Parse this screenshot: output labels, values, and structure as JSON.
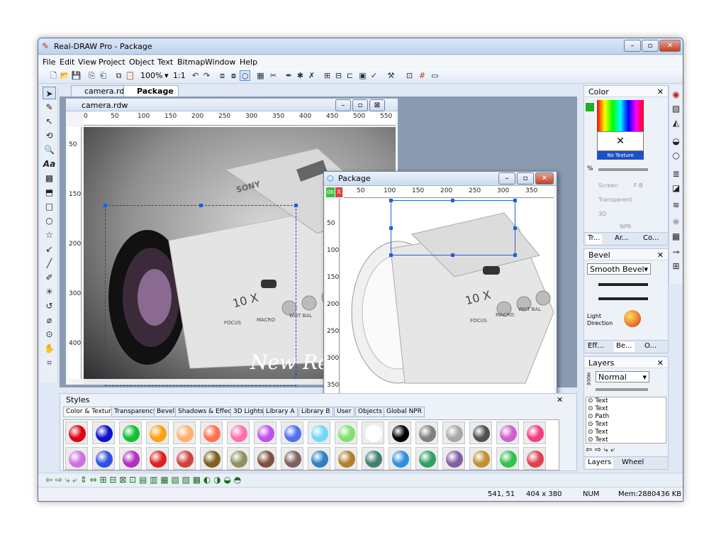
{
  "window": {
    "title": "Real-DRAW Pro - Package",
    "min": "–",
    "max": "▫",
    "close": "✕"
  },
  "menu": [
    "File",
    "Edit",
    "View",
    "Project",
    "Object",
    "Text",
    "Bitmap",
    "Window",
    "Help"
  ],
  "toolbar": {
    "zoom": "100%",
    "ratio": "1:1"
  },
  "doc_tabs": [
    "camera.rdw",
    "Package"
  ],
  "camera_window": {
    "title": "camera.rdw",
    "ruler": [
      "0",
      "50",
      "100",
      "150",
      "200",
      "250",
      "300",
      "350",
      "400",
      "450",
      "500",
      "550"
    ],
    "vruler": [
      "0",
      "50",
      "100",
      "150",
      "200",
      "250",
      "300",
      "350",
      "400"
    ],
    "brand": "SONY",
    "zoom_text": "10 X",
    "focus": "FOCUS",
    "macro": "MACRO",
    "whitebal": "WHT BAL",
    "script": "New Rea"
  },
  "package_window": {
    "title": "Package",
    "ok": "OK",
    "x": "X",
    "ruler": [
      "50",
      "100",
      "150",
      "200",
      "250",
      "300",
      "350"
    ],
    "vruler": [
      "50",
      "100",
      "150",
      "200",
      "250",
      "300",
      "350"
    ],
    "zoom_text": "10 X",
    "focus": "FOCUS",
    "macro": "MACRO",
    "whitebal": "WHT BAL"
  },
  "color_panel": {
    "title": "Color",
    "texture": "No Texture",
    "percent": "%",
    "screen": "Screen",
    "fb": "F-B",
    "transparent": "Transparent",
    "threed": "3D",
    "npr": "NPR",
    "tabs": [
      "Tr...",
      "Ar...",
      "Co..."
    ]
  },
  "bevel_panel": {
    "title": "Bevel",
    "type": "Smooth Bevel",
    "light": "Light",
    "direction": "Direction",
    "tabs": [
      "Eff...",
      "Be...",
      "O..."
    ]
  },
  "layers_panel": {
    "title": "Layers",
    "mode_label": "MODE",
    "mode": "Normal",
    "items": [
      "Text",
      "Text",
      "Path",
      "Text",
      "Text",
      "Text"
    ],
    "tabs": [
      "Layers",
      "Wheel"
    ]
  },
  "styles_panel": {
    "title": "Styles",
    "tabs": [
      "Color & Texture",
      "Transparency",
      "Bevel",
      "Shadows & Effects",
      "3D Lights",
      "Library A",
      "Library B",
      "User",
      "Objects",
      "Global NPR"
    ]
  },
  "swatch_colors_row1": [
    "#e00010",
    "#1010d0",
    "#10c030",
    "#ffa010",
    "#ffb070",
    "#ff7050",
    "#ff70b0",
    "#c050f0",
    "#5070f0",
    "#70d8ff",
    "#80e070",
    "#ffffff",
    "#000000",
    "#808080",
    "#a8a8a8",
    "#505050",
    "#d060d0",
    "#f04080"
  ],
  "swatch_colors_row2": [
    "#d070e0",
    "#3050e0",
    "#b030c0",
    "#e02020",
    "#d04040",
    "#806020",
    "#909060",
    "#805040",
    "#806060",
    "#3080c0",
    "#b08030",
    "#408070",
    "#3090e0",
    "#30a060",
    "#8060a0",
    "#c09030",
    "#30c050",
    "#e04050"
  ],
  "status": {
    "coords": "541, 51",
    "size": "404 x 380",
    "num": "NUM",
    "mem": "Mem:2880436 KB"
  }
}
